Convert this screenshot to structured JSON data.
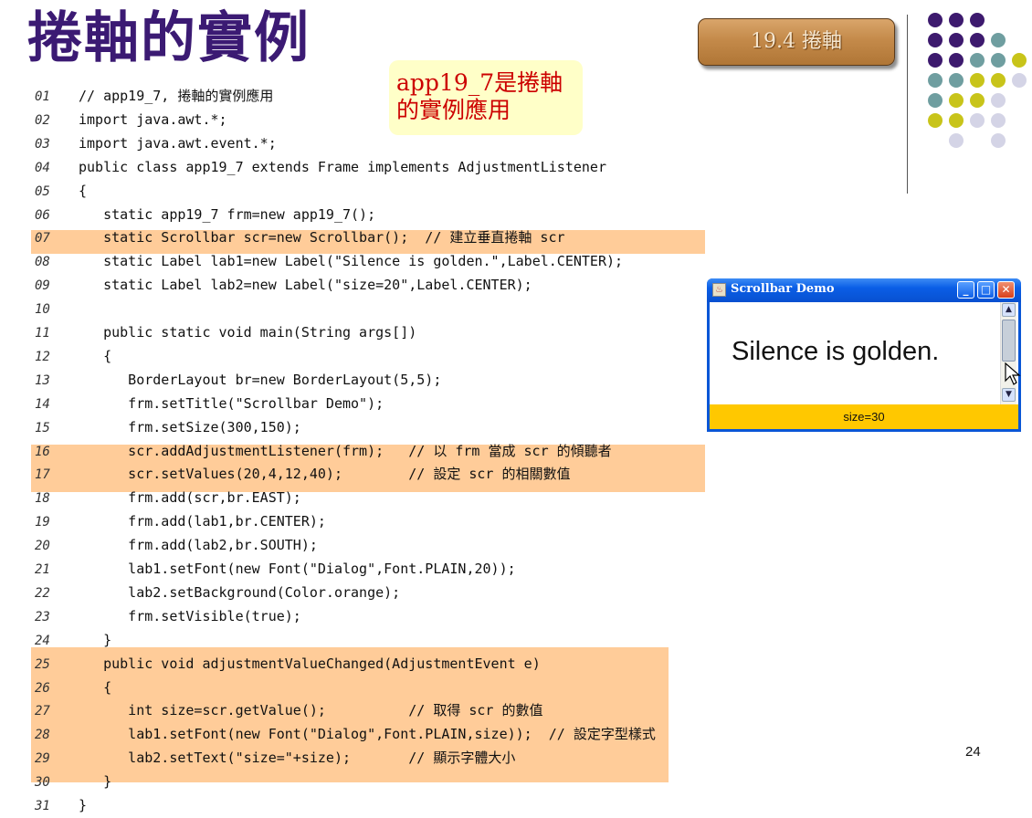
{
  "slide": {
    "title": "捲軸的實例",
    "section_button": "19.4 捲軸",
    "callout": "app19_7是捲軸的實例應用",
    "page_number": "24"
  },
  "code_lines": [
    {
      "n": "01",
      "t": "// app19_7, 捲軸的實例應用"
    },
    {
      "n": "02",
      "t": "import java.awt.*;"
    },
    {
      "n": "03",
      "t": "import java.awt.event.*;"
    },
    {
      "n": "04",
      "t": "public class app19_7 extends Frame implements AdjustmentListener"
    },
    {
      "n": "05",
      "t": "{"
    },
    {
      "n": "06",
      "t": "   static app19_7 frm=new app19_7();"
    },
    {
      "n": "07",
      "t": "   static Scrollbar scr=new Scrollbar();  // 建立垂直捲軸 scr"
    },
    {
      "n": "08",
      "t": "   static Label lab1=new Label(\"Silence is golden.\",Label.CENTER);"
    },
    {
      "n": "09",
      "t": "   static Label lab2=new Label(\"size=20\",Label.CENTER);"
    },
    {
      "n": "10",
      "t": ""
    },
    {
      "n": "11",
      "t": "   public static void main(String args[])"
    },
    {
      "n": "12",
      "t": "   {"
    },
    {
      "n": "13",
      "t": "      BorderLayout br=new BorderLayout(5,5);"
    },
    {
      "n": "14",
      "t": "      frm.setTitle(\"Scrollbar Demo\");"
    },
    {
      "n": "15",
      "t": "      frm.setSize(300,150);"
    },
    {
      "n": "16",
      "t": "      scr.addAdjustmentListener(frm);   // 以 frm 當成 scr 的傾聽者"
    },
    {
      "n": "17",
      "t": "      scr.setValues(20,4,12,40);        // 設定 scr 的相關數值"
    },
    {
      "n": "18",
      "t": "      frm.add(scr,br.EAST);"
    },
    {
      "n": "19",
      "t": "      frm.add(lab1,br.CENTER);"
    },
    {
      "n": "20",
      "t": "      frm.add(lab2,br.SOUTH);"
    },
    {
      "n": "21",
      "t": "      lab1.setFont(new Font(\"Dialog\",Font.PLAIN,20));"
    },
    {
      "n": "22",
      "t": "      lab2.setBackground(Color.orange);"
    },
    {
      "n": "23",
      "t": "      frm.setVisible(true);"
    },
    {
      "n": "24",
      "t": "   }"
    },
    {
      "n": "25",
      "t": "   public void adjustmentValueChanged(AdjustmentEvent e)"
    },
    {
      "n": "26",
      "t": "   {"
    },
    {
      "n": "27",
      "t": "      int size=scr.getValue();          // 取得 scr 的數值"
    },
    {
      "n": "28",
      "t": "      lab1.setFont(new Font(\"Dialog\",Font.PLAIN,size));  // 設定字型樣式"
    },
    {
      "n": "29",
      "t": "      lab2.setText(\"size=\"+size);       // 顯示字體大小"
    },
    {
      "n": "30",
      "t": "   }"
    },
    {
      "n": "31",
      "t": "}"
    }
  ],
  "demo_window": {
    "title": "Scrollbar Demo",
    "label_text": "Silence is golden.",
    "status_text": "size=30",
    "minimize_icon": "minimize-icon",
    "maximize_icon": "maximize-icon",
    "close_icon": "close-icon"
  },
  "colors": {
    "title": "#3b1a73",
    "highlight": "#ffcc99",
    "callout_bg": "#ffffc8",
    "callout_text": "#cc0000",
    "dot_purple": "#3d1a6e",
    "dot_teal": "#6f9ea0",
    "dot_olive": "#c8c41a",
    "dot_lavender": "#d4d4e6",
    "status_bar": "#ffc800"
  }
}
